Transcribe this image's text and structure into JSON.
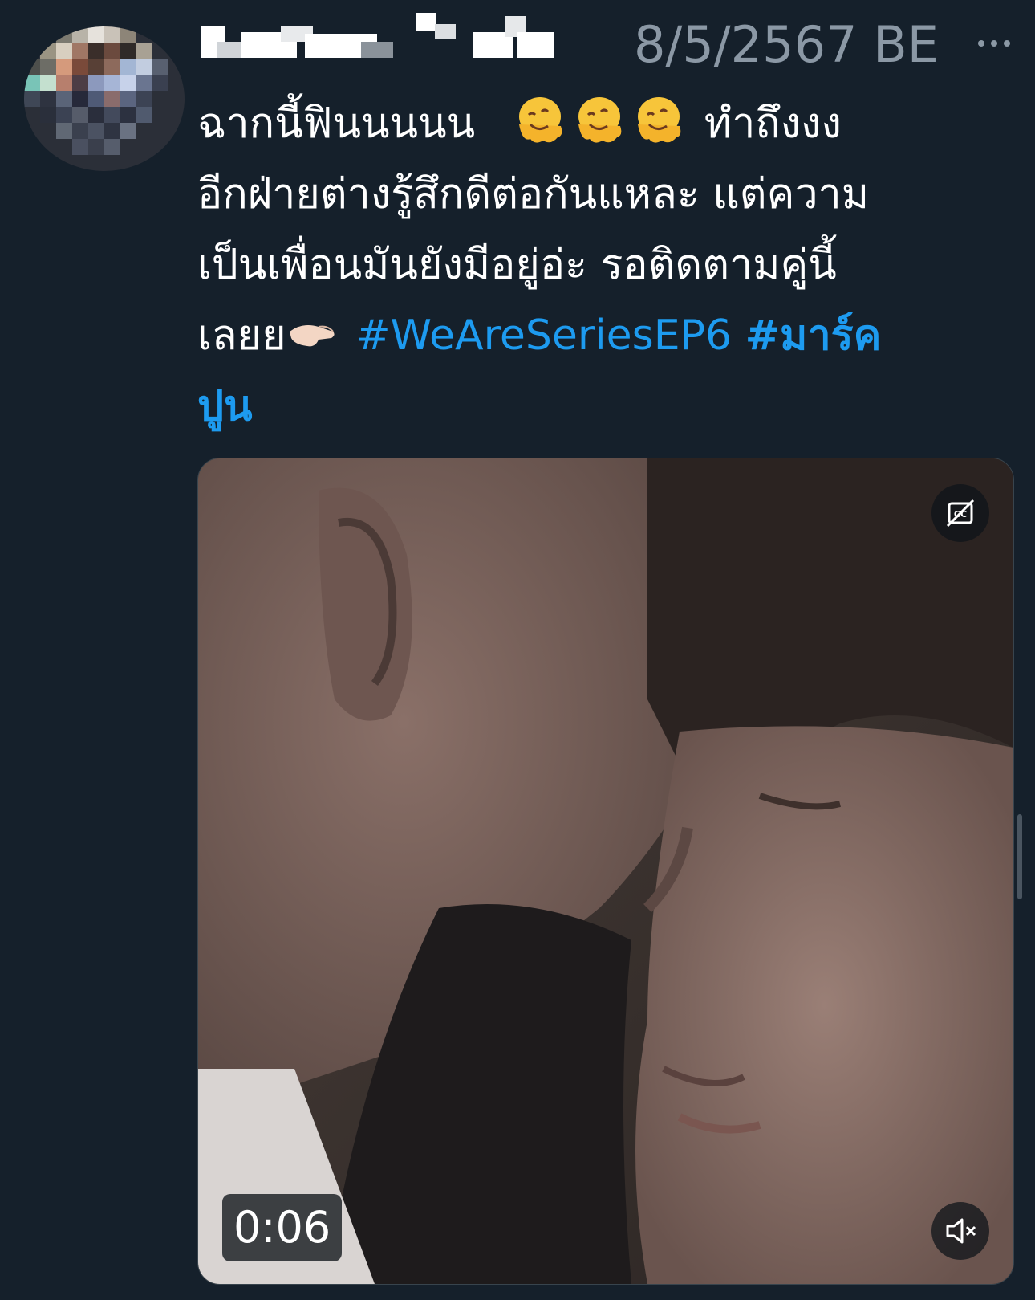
{
  "tweet": {
    "timestamp": "8/5/2567 BE",
    "more_icon": "more-horizontal-icon",
    "text_lines": {
      "l1_before": "ฉากนี้ฟินนนนน",
      "l1_after": "ทำถึงงง",
      "l2": "อีกฝ่ายต่างรู้สึกดีต่อกันแหละ แต่ความ",
      "l3": "เป็นเพื่อนมันยังมีอยู่อ่ะ รอติดตามคู่นี้",
      "l4_before": "เลยย",
      "hashtag1": "#WeAreSeriesEP6",
      "hashtag2_part1": "#มาร์ค",
      "hashtag2_part2": "ปูน"
    },
    "emojis": [
      "melting-face-emoji",
      "melting-face-emoji",
      "melting-face-emoji",
      "pinching-hand-emoji"
    ]
  },
  "video": {
    "duration": "0:06",
    "cc_icon": "captions-off-icon",
    "mute_icon": "volume-muted-icon"
  },
  "colors": {
    "background": "#15202b",
    "hashtag": "#1d9bf0",
    "muted_text": "#8b98a5"
  }
}
